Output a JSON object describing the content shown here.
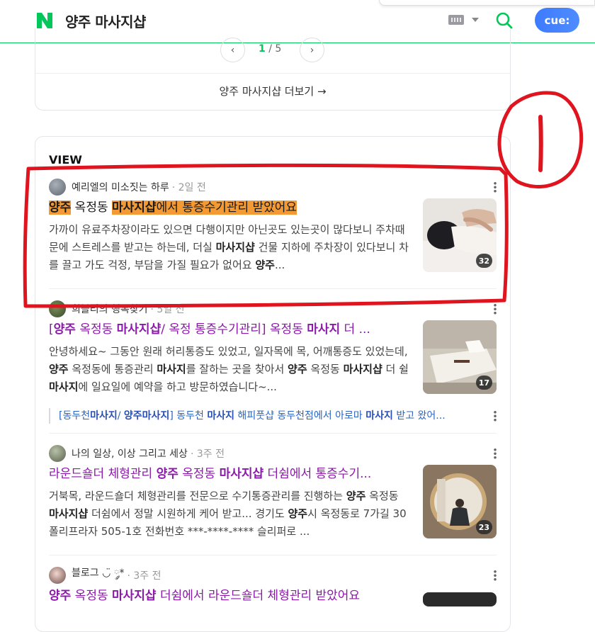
{
  "header": {
    "query": "양주 마사지샵",
    "cue_label": "cue:"
  },
  "prev_section": {
    "pager": {
      "current": "1",
      "total": "/ 5"
    },
    "more_link": "양주 마사지샵 더보기 →"
  },
  "view": {
    "title": "VIEW",
    "posts": [
      {
        "author": "예리엘의 미소짓는 하루",
        "time": "· 2일 전",
        "title_html": "<span class='hl'><b>양주</b></span> 옥정동 <span class='hl'><b>마사지샵</b></span><span class='hl'>에서 통증수기관리 받았어요</span>",
        "desc_html": "가까이 유료주차장이라도 있으면 다행이지만 아닌곳도 있는곳이 많다보니 주차때문에 스트레스를 받고는 하는데, 더실 <b>마사지샵</b> 건물 지하에 주차장이 있다보니 차를 끌고 가도 걱정, 부담을 가질 필요가 없어요 <b>양주</b>...",
        "image_count": "32"
      },
      {
        "author": "희블리의 행복찾기",
        "time": "· 5일 전",
        "title_html": "[<b>양주</b> 옥정동 <b>마사지샵</b>/ 옥정 통증수기관리] 옥정동 <b>마사지</b> 더 ...",
        "desc_html": "안녕하세요~ 그동안 원래 허리통증도 있었고, 일자목에 목, 어깨통증도 있었는데, <b>양주</b> 옥정동에 통증관리 <b>마사지</b>를 잘하는 곳을 찾아서 <b>양주</b> 옥정동 <b>마사지샵</b> 더 쉴 <b>마사지</b>에 일요일에 예약을 하고 방문하였습니다~...",
        "image_count": "17",
        "sub_link_html": "[동두천<b>마사지</b>/ <b>양주마사지</b>] 동두천 <b>마사지</b> 해피풋샵 동두천점에서 아로마 <b>마사지</b> 받고 왔어..."
      },
      {
        "author": "나의 일상, 이상 그리고 세상",
        "time": "· 3주 전",
        "title_html": "라운드숄더 체형관리 <b>양주</b> 옥정동 <b>마사지샵</b> 더쉼에서 통증수기...",
        "desc_html": "거북목, 라운드숄더 체형관리를 전문으로 수기통증관리를 진행하는 <b>양주</b> 옥정동 <b>마사지샵</b> 더쉼에서 정말 시원하게 케어 받고... 경기도 <b>양주</b>시 옥정동로 7가길 30 폴리프라자 505-1호 전화번호 ***-****-**** 슬리퍼로 ...",
        "image_count": "23"
      },
      {
        "author": "블로그 ◡̈ ༘*",
        "time": "· 3주 전",
        "title_html": "<b>양주</b> 옥정동 <b>마사지샵</b> 더쉼에서 라운드숄더 체형관리 받았어요"
      }
    ]
  },
  "annotation": {
    "label": "1",
    "color": "#e0141e"
  }
}
